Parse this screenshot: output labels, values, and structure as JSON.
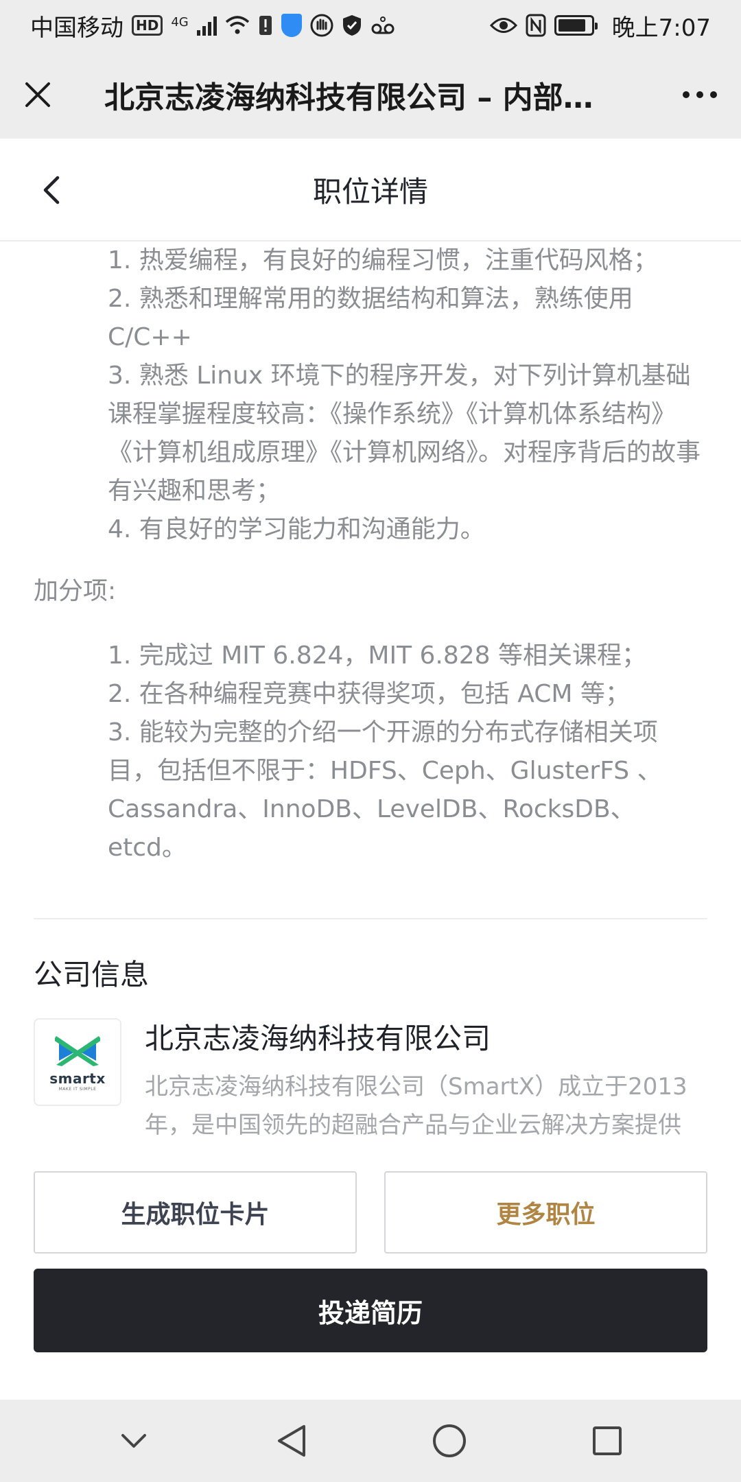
{
  "status_bar": {
    "carrier": "中国移动",
    "network": "4G",
    "time": "晚上7:07"
  },
  "webview": {
    "title": "北京志凌海纳科技有限公司 – 内部…"
  },
  "page": {
    "title": "职位详情"
  },
  "requirements": [
    "1. 热爱编程，有良好的编程习惯，注重代码风格；",
    "2. 熟悉和理解常用的数据结构和算法，熟练使用 C/C++",
    "3. 熟悉 Linux 环境下的程序开发，对下列计算机基础课程掌握程度较高：《操作系统》《计算机体系结构》《计算机组成原理》《计算机网络》。对程序背后的故事有兴趣和思考；",
    "4. 有良好的学习能力和沟通能力。"
  ],
  "bonus": {
    "label": "加分项:",
    "items": [
      "1. 完成过 MIT 6.824，MIT 6.828 等相关课程；",
      "2. 在各种编程竞赛中获得奖项，包括 ACM 等；",
      "3. 能较为完整的介绍一个开源的分布式存储相关项目，包括但不限于：HDFS、Ceph、GlusterFS 、Cassandra、InnoDB、LevelDB、RocksDB、etcd。"
    ]
  },
  "company": {
    "section_title": "公司信息",
    "logo_text": "smartx",
    "logo_subtext": "MAKE IT SIMPLE",
    "name": "北京志凌海纳科技有限公司",
    "description": "北京志凌海纳科技有限公司（SmartX）成立于2013年，是中国领先的超融合产品与企业云解决方案提供"
  },
  "actions": {
    "card_button": "生成职位卡片",
    "more_button": "更多职位",
    "submit_button": "投递简历"
  },
  "colors": {
    "accent_gold": "#b08442",
    "submit_bg": "#23252b",
    "logo_green": "#2bb673",
    "logo_blue": "#1e7fd8"
  }
}
